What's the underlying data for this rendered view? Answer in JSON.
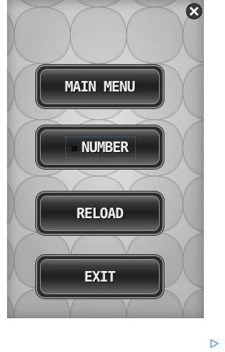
{
  "menu": {
    "main_menu_label": "MAIN MENU",
    "number_label": "NUMBER",
    "reload_label": "RELOAD",
    "exit_label": "EXIT"
  },
  "icons": {
    "close": "close-icon",
    "ad_choices": "play-triangle-icon"
  },
  "colors": {
    "panel_background": "#b0b0b0",
    "button_face": "#1f1f1f",
    "button_text": "#ededed",
    "ad_icon": "#4aa3d8"
  }
}
